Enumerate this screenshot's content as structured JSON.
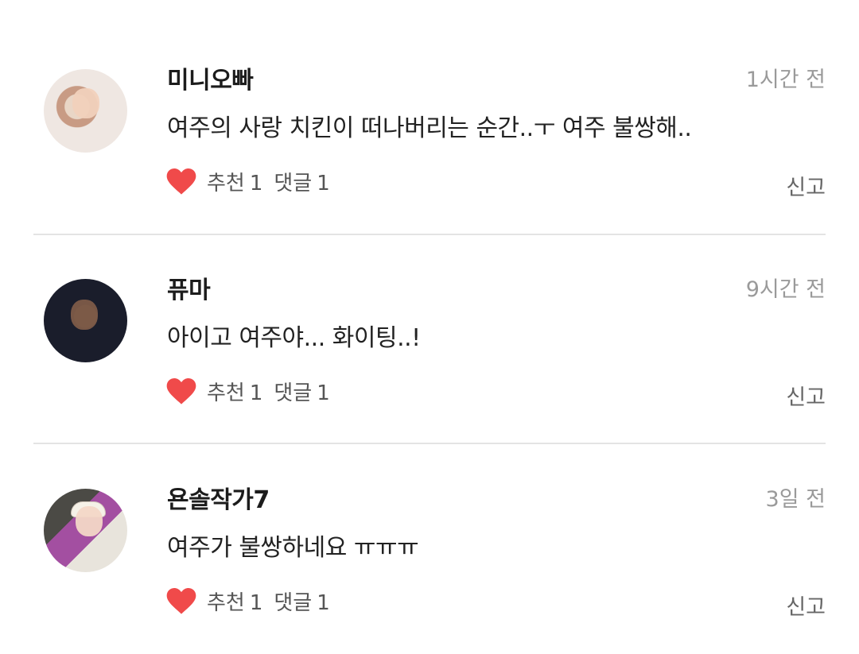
{
  "comments": [
    {
      "username": "미니오빠",
      "time": "1시간 전",
      "text": "여주의 사랑 치킨이 떠나버리는 순간..ㅜ 여주 불쌍해..",
      "recommend_label": "추천",
      "recommend_count": "1",
      "reply_label": "댓글",
      "reply_count": "1",
      "report_label": "신고"
    },
    {
      "username": "퓨마",
      "time": "9시간 전",
      "text": "아이고 여주야... 화이팅..!",
      "recommend_label": "추천",
      "recommend_count": "1",
      "reply_label": "댓글",
      "reply_count": "1",
      "report_label": "신고"
    },
    {
      "username": "욘솔작가7",
      "time": "3일 전",
      "text": "여주가 불쌍하네요 ㅠㅠㅠ",
      "recommend_label": "추천",
      "recommend_count": "1",
      "reply_label": "댓글",
      "reply_count": "1",
      "report_label": "신고"
    }
  ],
  "colors": {
    "heart": "#f04a4a",
    "divider": "#e4e4e4",
    "time_text": "#9a9a9a"
  },
  "icons": {
    "like": "heart-icon"
  }
}
